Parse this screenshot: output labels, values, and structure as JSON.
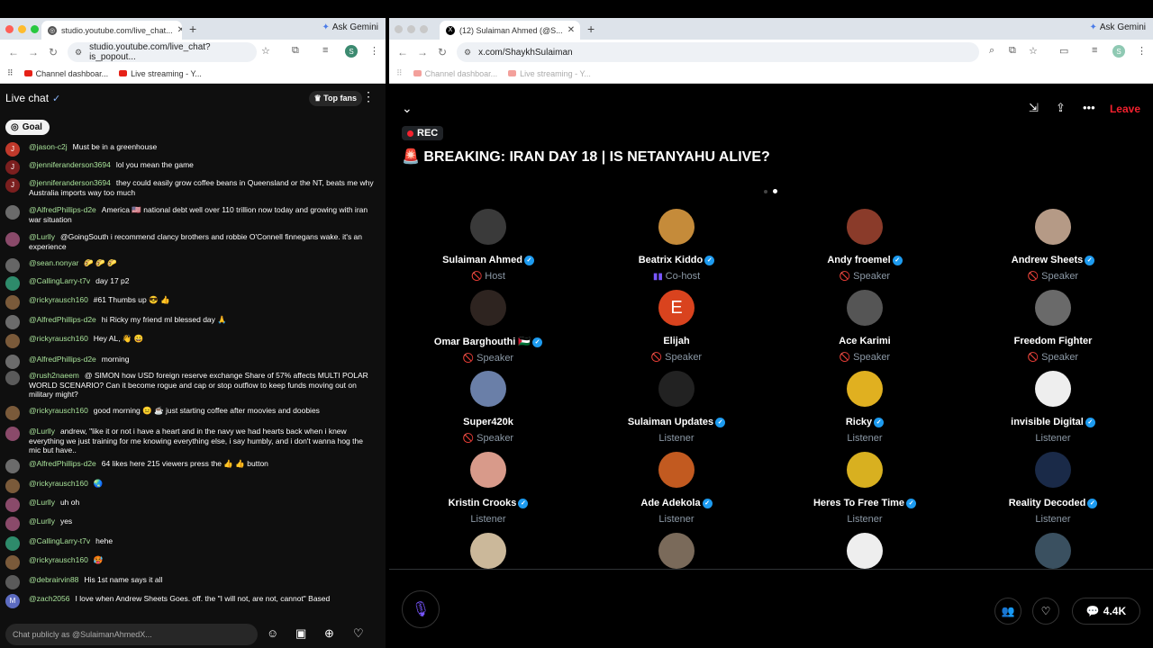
{
  "left_browser": {
    "tab_title": "studio.youtube.com/live_chat...",
    "url": "studio.youtube.com/live_chat?is_popout...",
    "ask_gemini": "Ask Gemini",
    "profile_initial": "S",
    "bookmarks": [
      "Channel dashboar...",
      "Live streaming - Y..."
    ]
  },
  "right_browser": {
    "tab_title": "(12) Sulaiman Ahmed (@S...",
    "url": "x.com/ShaykhSulaiman",
    "ask_gemini": "Ask Gemini",
    "profile_initial": "S",
    "bookmarks": [
      "Channel dashboar...",
      "Live streaming - Y..."
    ]
  },
  "chat": {
    "title": "Live chat",
    "top_fans": "Top fans",
    "goal": "Goal",
    "input_placeholder": "Chat publicly as @SulaimanAhmedX...",
    "messages": [
      {
        "initial": "J",
        "color": "#c0392b",
        "author": "@jason-c2j",
        "text": "Must be in a greenhouse"
      },
      {
        "initial": "J",
        "color": "#7b1f1f",
        "author": "@jenniferanderson3694",
        "text": "lol you mean the game"
      },
      {
        "initial": "J",
        "color": "#7b1f1f",
        "author": "@jenniferanderson3694",
        "text": "they could easily grow coffee beans in Queensland or the NT, beats me why Australia imports way too much"
      },
      {
        "initial": "",
        "color": "#6b6b6b",
        "author": "@AlfredPhillips-d2e",
        "text": "America 🇺🇸 national debt well over 110 trillion now today and growing with iran war situation"
      },
      {
        "initial": "",
        "color": "#8a4a6a",
        "author": "@Lurlly",
        "text": "@GoingSouth i recommend clancy brothers and robbie O'Connell finnegans wake. it's an experience"
      },
      {
        "initial": "",
        "color": "#666",
        "author": "@sean.nonyar",
        "text": "🌮 🌮 🌮"
      },
      {
        "initial": "",
        "color": "#2e8b6b",
        "author": "@CallingLarry-t7v",
        "text": "day 17 p2"
      },
      {
        "initial": "",
        "color": "#7a5a3a",
        "author": "@rickyrausch160",
        "text": "#61 Thumbs up 😎 👍"
      },
      {
        "initial": "",
        "color": "#6b6b6b",
        "author": "@AlfredPhillips-d2e",
        "text": "hi Ricky my friend ml blessed day 🙏"
      },
      {
        "initial": "",
        "color": "#7a5a3a",
        "author": "@rickyrausch160",
        "text": "Hey AL, 👋 😀"
      },
      {
        "initial": "",
        "color": "#6b6b6b",
        "author": "@AlfredPhillips-d2e",
        "text": "morning"
      },
      {
        "initial": "",
        "color": "#5a5a5a",
        "author": "@rush2naeem",
        "text": "@ SIMON how USD foreign reserve exchange Share of 57% affects MULTI POLAR WORLD SCENARIO? Can it become rogue and cap or stop outflow to keep funds moving out on military might?"
      },
      {
        "initial": "",
        "color": "#7a5a3a",
        "author": "@rickyrausch160",
        "text": "good morning 😑 ☕ just starting coffee after moovies and doobies"
      },
      {
        "initial": "",
        "color": "#8a4a6a",
        "author": "@Lurlly",
        "text": "andrew, \"like it or not i have a heart and in the navy we had hearts back when i knew everything we just training for me knowing everything else, i say humbly, and i don't wanna hog the mic but have.."
      },
      {
        "initial": "",
        "color": "#6b6b6b",
        "author": "@AlfredPhillips-d2e",
        "text": "64 likes here 215 viewers press the 👍 👍 button"
      },
      {
        "initial": "",
        "color": "#7a5a3a",
        "author": "@rickyrausch160",
        "text": "🌏"
      },
      {
        "initial": "",
        "color": "#8a4a6a",
        "author": "@Lurlly",
        "text": "uh oh"
      },
      {
        "initial": "",
        "color": "#8a4a6a",
        "author": "@Lurlly",
        "text": "yes"
      },
      {
        "initial": "",
        "color": "#2e8b6b",
        "author": "@CallingLarry-t7v",
        "text": "hehe"
      },
      {
        "initial": "",
        "color": "#7a5a3a",
        "author": "@rickyrausch160",
        "text": "🥵"
      },
      {
        "initial": "",
        "color": "#5a5a5a",
        "author": "@debrairvin88",
        "text": "His 1st name says it all"
      },
      {
        "initial": "M",
        "color": "#5c6bc0",
        "author": "@zach2056",
        "text": "I love when Andrew Sheets Goes. off. the \"I will not, are not, cannot\" Based"
      }
    ]
  },
  "space": {
    "rec": "REC",
    "title": "🚨 BREAKING: IRAN DAY 18 | IS NETANYAHU ALIVE?",
    "leave": "Leave",
    "comment_count": "4.4K",
    "participants": [
      {
        "name": "Sulaiman Ahmed",
        "verified": true,
        "role": "Host",
        "mic": true,
        "pic": "#3a3a3a",
        "initial": ""
      },
      {
        "name": "Beatrix Kiddo",
        "verified": true,
        "role": "Co-host",
        "mic": true,
        "cohost": true,
        "pic": "#c58b3a",
        "initial": ""
      },
      {
        "name": "Andy froemel",
        "verified": true,
        "role": "Speaker",
        "mic": true,
        "pic": "#8a3b2a",
        "initial": ""
      },
      {
        "name": "Andrew Sheets",
        "verified": true,
        "role": "Speaker",
        "mic": true,
        "pic": "#b59a86",
        "initial": ""
      },
      {
        "name": "Omar Barghouthi 🇵🇸",
        "verified": true,
        "role": "Speaker",
        "mic": true,
        "pic": "#2e2420",
        "initial": ""
      },
      {
        "name": "Elijah",
        "verified": false,
        "role": "Speaker",
        "mic": true,
        "pic": "#d9431e",
        "initial": "E"
      },
      {
        "name": "Ace Karimi",
        "verified": false,
        "role": "Speaker",
        "mic": true,
        "pic": "#555",
        "initial": ""
      },
      {
        "name": "Freedom Fighter",
        "verified": false,
        "role": "Speaker",
        "mic": true,
        "pic": "#6a6a6a",
        "initial": ""
      },
      {
        "name": "Super420k",
        "verified": false,
        "role": "Speaker",
        "mic": true,
        "pic": "#6a7fa8",
        "initial": ""
      },
      {
        "name": "Sulaiman Updates",
        "verified": true,
        "role": "Listener",
        "mic": false,
        "pic": "#222",
        "initial": ""
      },
      {
        "name": "Ricky",
        "verified": true,
        "role": "Listener",
        "mic": false,
        "pic": "#e0b020",
        "initial": ""
      },
      {
        "name": "invisible Digital",
        "verified": true,
        "role": "Listener",
        "mic": false,
        "pic": "#eee",
        "initial": ""
      },
      {
        "name": "Kristin Crooks",
        "verified": true,
        "role": "Listener",
        "mic": false,
        "pic": "#d89a8a",
        "initial": ""
      },
      {
        "name": "Ade Adekola",
        "verified": true,
        "role": "Listener",
        "mic": false,
        "pic": "#c25a20",
        "initial": ""
      },
      {
        "name": "Heres To Free Time",
        "verified": true,
        "role": "Listener",
        "mic": false,
        "pic": "#d8b020",
        "initial": ""
      },
      {
        "name": "Reality Decoded",
        "verified": true,
        "role": "Listener",
        "mic": false,
        "pic": "#1a2a48",
        "initial": ""
      },
      {
        "name": "",
        "verified": false,
        "role": "",
        "mic": false,
        "pic": "#cbb89a",
        "initial": ""
      },
      {
        "name": "",
        "verified": false,
        "role": "",
        "mic": false,
        "pic": "#7a6a5a",
        "initial": ""
      },
      {
        "name": "",
        "verified": false,
        "role": "",
        "mic": false,
        "pic": "#eee",
        "initial": ""
      },
      {
        "name": "",
        "verified": false,
        "role": "",
        "mic": false,
        "pic": "#3a5060",
        "initial": ""
      }
    ]
  }
}
